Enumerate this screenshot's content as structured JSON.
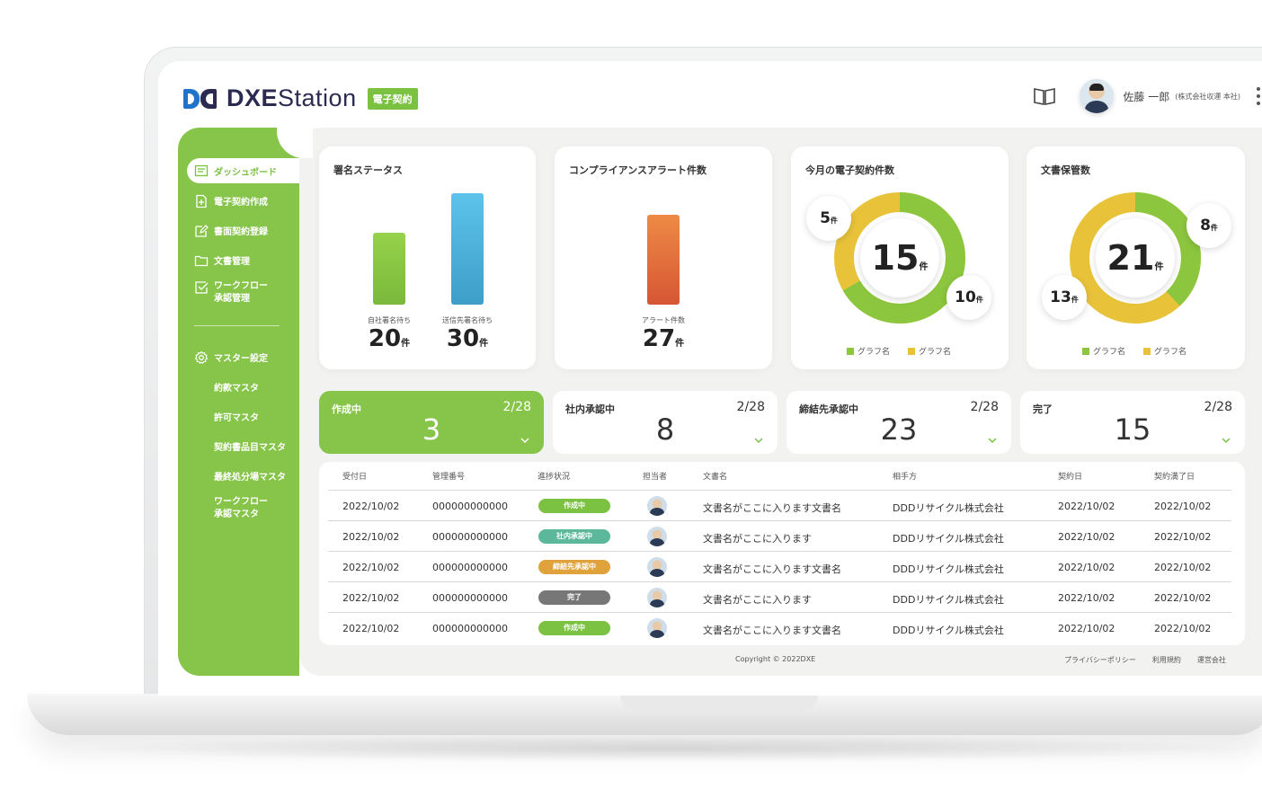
{
  "app": {
    "logo_bold": "DXE",
    "logo_light": "Station",
    "badge": "電子契約"
  },
  "header": {
    "user_name": "佐藤 一郎",
    "user_org": "(株式会社収運 本社)"
  },
  "sidebar": {
    "items": [
      {
        "label": "ダッシュボード"
      },
      {
        "label": "電子契約作成"
      },
      {
        "label": "書面契約登録"
      },
      {
        "label": "文書管理"
      },
      {
        "label": "ワークフロー\n承認管理"
      },
      {
        "label": "マスター設定"
      },
      {
        "label": "約款マスタ"
      },
      {
        "label": "許可マスタ"
      },
      {
        "label": "契約書品目マスタ"
      },
      {
        "label": "最終処分場マスタ"
      },
      {
        "label": "ワークフロー\n承認マスタ"
      }
    ]
  },
  "cards": {
    "signature": {
      "title": "署名ステータス",
      "bars": [
        {
          "label": "自社署名待ち",
          "value": "20",
          "unit": "件",
          "color": "#8cc63f"
        },
        {
          "label": "送信先署名待ち",
          "value": "30",
          "unit": "件",
          "color": "#4fb3dc"
        }
      ]
    },
    "compliance": {
      "title": "コンプライアンスアラート件数",
      "bars": [
        {
          "label": "アラート件数",
          "value": "27",
          "unit": "件",
          "color": "#e36f3d"
        }
      ]
    },
    "monthly": {
      "title": "今月の電子契約件数",
      "total": "15",
      "unit": "件",
      "segments": [
        {
          "value": "10",
          "color": "#8cc63f"
        },
        {
          "value": "5",
          "color": "#e8c33a"
        }
      ],
      "legend": [
        "グラフ名",
        "グラフ名"
      ]
    },
    "storage": {
      "title": "文書保管数",
      "total": "21",
      "unit": "件",
      "segments": [
        {
          "value": "8",
          "color": "#8cc63f"
        },
        {
          "value": "13",
          "color": "#e8c33a"
        }
      ],
      "legend": [
        "グラフ名",
        "グラフ名"
      ]
    }
  },
  "tiles": [
    {
      "label": "作成中",
      "count": "3",
      "fraction": "2/28",
      "active": true
    },
    {
      "label": "社内承認中",
      "count": "8",
      "fraction": "2/28",
      "active": false
    },
    {
      "label": "締結先承認中",
      "count": "23",
      "fraction": "2/28",
      "active": false
    },
    {
      "label": "完了",
      "count": "15",
      "fraction": "2/28",
      "active": false
    }
  ],
  "table": {
    "headers": [
      "受付日",
      "管理番号",
      "進捗状況",
      "担当者",
      "文書名",
      "相手方",
      "契約日",
      "契約満了日"
    ],
    "rows": [
      {
        "date": "2022/10/02",
        "id": "000000000000",
        "status": "作成中",
        "status_color": "#7bc142",
        "doc": "文書名がここに入ります文書名",
        "partner": "DDDリサイクル株式会社",
        "contract": "2022/10/02",
        "expire": "2022/10/02"
      },
      {
        "date": "2022/10/02",
        "id": "000000000000",
        "status": "社内承認中",
        "status_color": "#5bb89a",
        "doc": "文書名がここに入ります",
        "partner": "DDDリサイクル株式会社",
        "contract": "2022/10/02",
        "expire": "2022/10/02"
      },
      {
        "date": "2022/10/02",
        "id": "000000000000",
        "status": "締結先承認中",
        "status_color": "#e0a23a",
        "doc": "文書名がここに入ります文書名",
        "partner": "DDDリサイクル株式会社",
        "contract": "2022/10/02",
        "expire": "2022/10/02"
      },
      {
        "date": "2022/10/02",
        "id": "000000000000",
        "status": "完了",
        "status_color": "#777777",
        "doc": "文書名がここに入ります",
        "partner": "DDDリサイクル株式会社",
        "contract": "2022/10/02",
        "expire": "2022/10/02"
      },
      {
        "date": "2022/10/02",
        "id": "000000000000",
        "status": "作成中",
        "status_color": "#7bc142",
        "doc": "文書名がここに入ります文書名",
        "partner": "DDDリサイクル株式会社",
        "contract": "2022/10/02",
        "expire": "2022/10/02"
      }
    ]
  },
  "footer": {
    "copyright": "Copyright © 2022DXE",
    "links": [
      "プライバシーポリシー",
      "利用規約",
      "運営会社"
    ]
  }
}
